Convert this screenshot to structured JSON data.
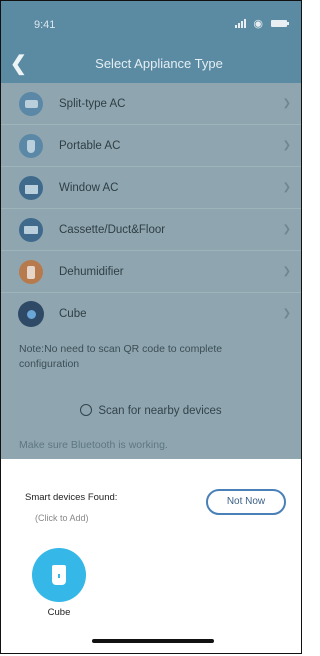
{
  "status_bar": {
    "time": "9:41"
  },
  "nav": {
    "title": "Select Appliance Type"
  },
  "appliances": [
    {
      "label": "Split-type AC",
      "icon": "split-ac-icon"
    },
    {
      "label": "Portable AC",
      "icon": "portable-ac-icon"
    },
    {
      "label": "Window AC",
      "icon": "window-ac-icon"
    },
    {
      "label": "Cassette/Duct&Floor",
      "icon": "cassette-icon"
    },
    {
      "label": "Dehumidifier",
      "icon": "dehumidifier-icon"
    },
    {
      "label": "Cube",
      "icon": "cube-icon"
    }
  ],
  "note": "Note:No need to scan QR code to complete configuration",
  "scan_label": "Scan for nearby devices",
  "bluetooth_hint": "Make sure Bluetooth is working.",
  "sheet": {
    "found_label": "Smart devices Found:",
    "hint": "(Click to Add)",
    "not_now": "Not Now",
    "devices": [
      {
        "label": "Cube",
        "icon": "cube-device-icon"
      }
    ]
  },
  "colors": {
    "header": "#5b8ba3",
    "overlay_bg": "#8fa6b0",
    "accent": "#4a80b8",
    "device_icon": "#35b8e8"
  }
}
